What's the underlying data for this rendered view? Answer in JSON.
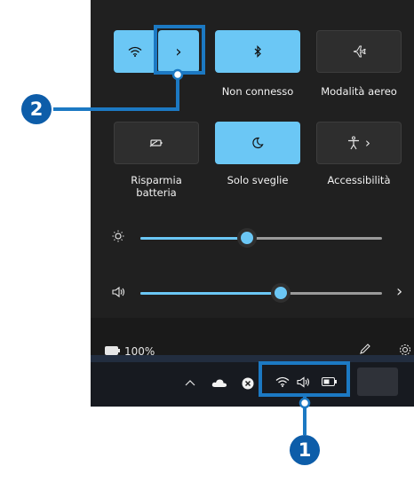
{
  "tiles": {
    "wifi": {
      "label": "",
      "expand_glyph": "›",
      "state": "on"
    },
    "bluetooth": {
      "label": "Non connesso",
      "state": "on"
    },
    "airplane": {
      "label": "Modalità aereo",
      "state": "off"
    },
    "battery_saver": {
      "label_line1": "Risparmia",
      "label_line2": "batteria",
      "state": "off"
    },
    "focus": {
      "label": "Solo sveglie",
      "state": "on"
    },
    "accessibility": {
      "label": "Accessibilità",
      "expand_glyph": "›",
      "state": "off"
    }
  },
  "sliders": {
    "brightness": {
      "level": 0.44
    },
    "volume": {
      "level": 0.58,
      "expand_glyph": "›"
    }
  },
  "footer": {
    "battery_text": "100%"
  },
  "callouts": {
    "one": "1",
    "two": "2"
  },
  "colors": {
    "accent": "#6bc7f5",
    "callout": "#0d5da9",
    "panel": "#202020"
  }
}
